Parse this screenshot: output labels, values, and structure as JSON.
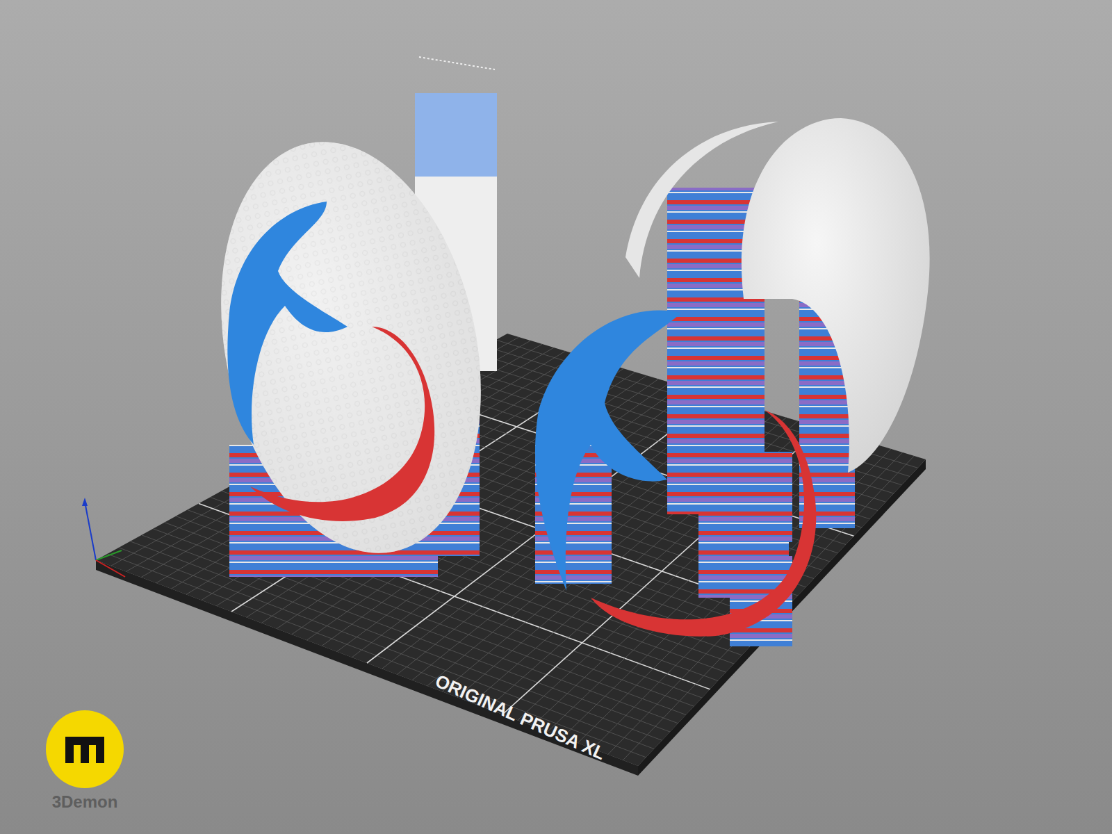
{
  "bed": {
    "label": "ORIGINAL PRUSA XL"
  },
  "watermark": {
    "label": "3Demon"
  }
}
